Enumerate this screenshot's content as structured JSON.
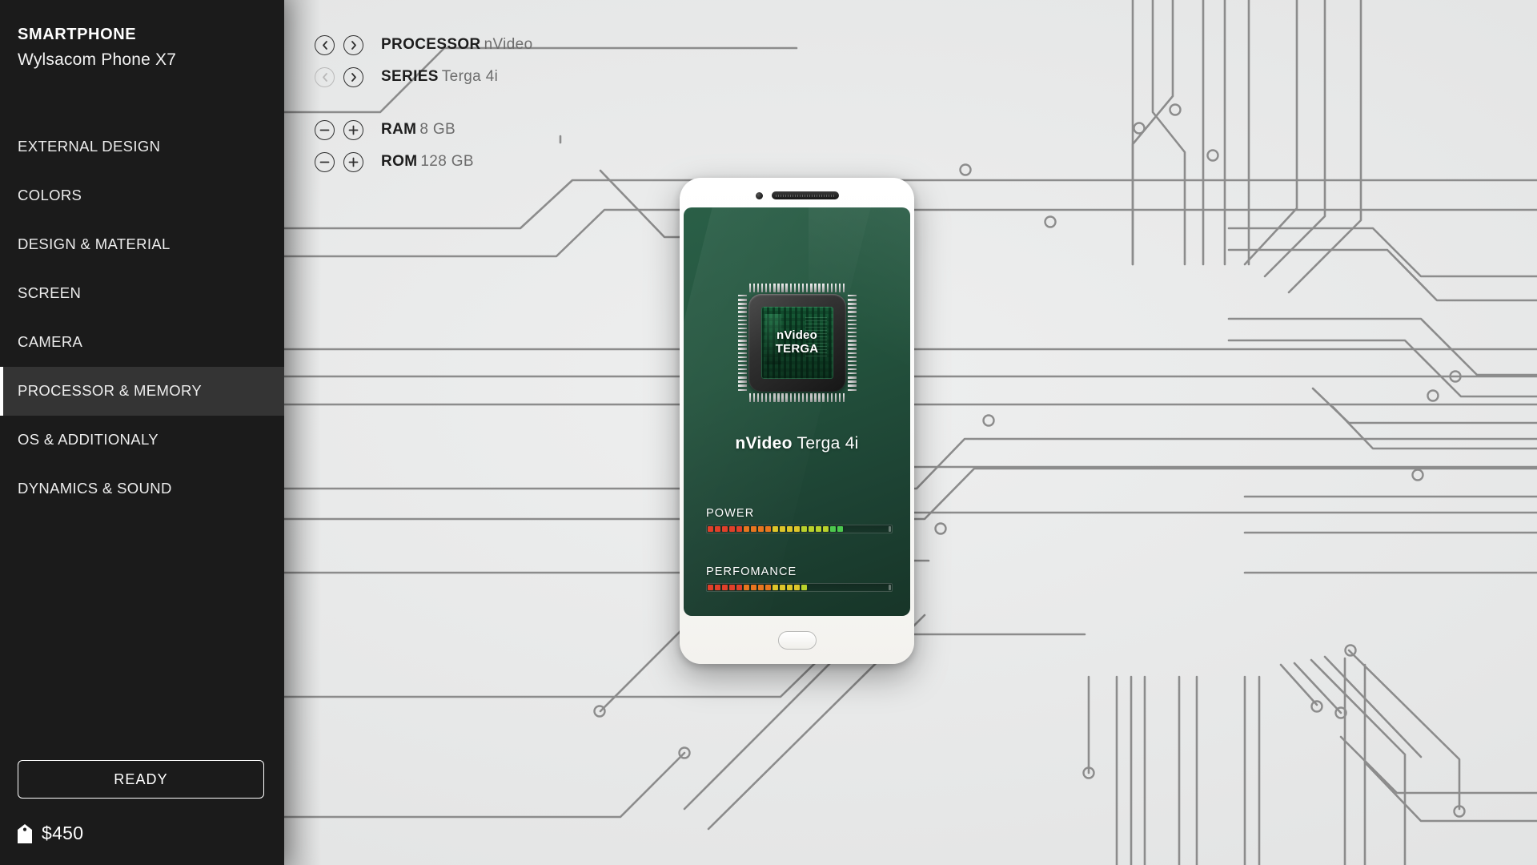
{
  "sidebar": {
    "brand": {
      "kind": "SMARTPHONE",
      "model": "Wylsacom Phone X7"
    },
    "items": [
      {
        "label": "EXTERNAL DESIGN",
        "active": false
      },
      {
        "label": "COLORS",
        "active": false
      },
      {
        "label": "DESIGN & MATERIAL",
        "active": false
      },
      {
        "label": "SCREEN",
        "active": false
      },
      {
        "label": "CAMERA",
        "active": false
      },
      {
        "label": "PROCESSOR & MEMORY",
        "active": true
      },
      {
        "label": "OS & ADDITIONALY",
        "active": false
      },
      {
        "label": "DYNAMICS & SOUND",
        "active": false
      }
    ],
    "ready_label": "READY",
    "price": "$450",
    "price_icon": "price-tag-icon"
  },
  "controls": {
    "selectors": [
      {
        "key": "PROCESSOR",
        "value": "nVideo",
        "prev_icon": "chevron-left-icon",
        "next_icon": "chevron-right-icon",
        "prev_disabled": false
      },
      {
        "key": "SERIES",
        "value": "Terga 4i",
        "prev_icon": "chevron-left-icon",
        "next_icon": "chevron-right-icon",
        "prev_disabled": true
      }
    ],
    "steppers": [
      {
        "key": "RAM",
        "value": "8 GB",
        "minus_icon": "minus-circle-icon",
        "plus_icon": "plus-circle-icon"
      },
      {
        "key": "ROM",
        "value": "128 GB",
        "minus_icon": "minus-circle-icon",
        "plus_icon": "plus-circle-icon"
      }
    ]
  },
  "phone": {
    "chip": {
      "line1": "nVideo",
      "line2": "TERGA"
    },
    "processor_brand": "nVideo",
    "processor_model": "Terga 4i",
    "meters": [
      {
        "label": "POWER",
        "filled": 19,
        "total": 27
      },
      {
        "label": "PERFOMANCE",
        "filled": 14,
        "total": 27
      }
    ],
    "home_button_icon": "home-button-icon",
    "camera_icon": "front-camera-icon",
    "speaker_icon": "earpiece-speaker-icon"
  },
  "colors": {
    "sidebar_bg": "#1b1b1b",
    "sidebar_active_bg": "#343434",
    "main_bg": "#e9eaea",
    "trace": "#8c8c8c",
    "screen_green_light": "#2a5f47",
    "screen_green_dark": "#173528",
    "accent_white": "#ffffff"
  }
}
